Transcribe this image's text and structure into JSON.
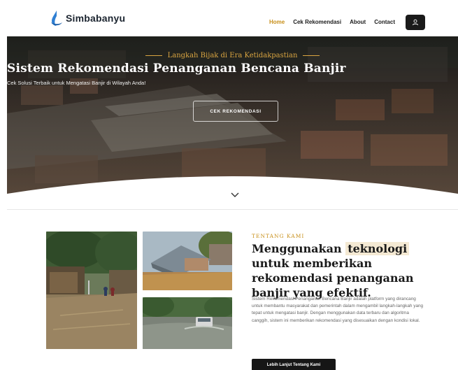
{
  "brand": {
    "name": "Simbabanyu"
  },
  "nav": {
    "items": [
      {
        "label": "Home",
        "active": true
      },
      {
        "label": "Cek Rekomendasi",
        "active": false
      },
      {
        "label": "About",
        "active": false
      },
      {
        "label": "Contact",
        "active": false
      }
    ],
    "user_icon": "user-icon"
  },
  "hero": {
    "kicker": "Langkah Bijak di Era Ketidakpastian",
    "title": "Sistem Rekomendasi Penanganan Bencana Banjir",
    "subtitle": "Cek Solusi Terbaik untuk Mengatasi Banjir di Wilayah Anda!",
    "button_label": "CEK REKOMENDASI",
    "scroll_icon": "chevron-down-icon"
  },
  "about": {
    "label": "TENTANG KAMI",
    "title_before": "Menggunakan",
    "title_highlight": "teknologi",
    "title_after": "untuk memberikan rekomendasi penanganan banjir yang efektif.",
    "body": "Sistem Rekomendasi Penanganan Bencana Banjir adalah platform yang dirancang untuk membantu masyarakat dan pemerintah dalam mengambil langkah-langkah yang tepat untuk mengatasi banjir. Dengan menggunakan data terbaru dan algoritma canggih, sistem ini memberikan rekomendasi yang disesuaikan dengan kondisi lokal.",
    "button_label": "Lebih Lanjut Tentang Kami"
  },
  "colors": {
    "accent": "#c8901b",
    "dark": "#161616",
    "highlight": "#f4e9d3"
  }
}
